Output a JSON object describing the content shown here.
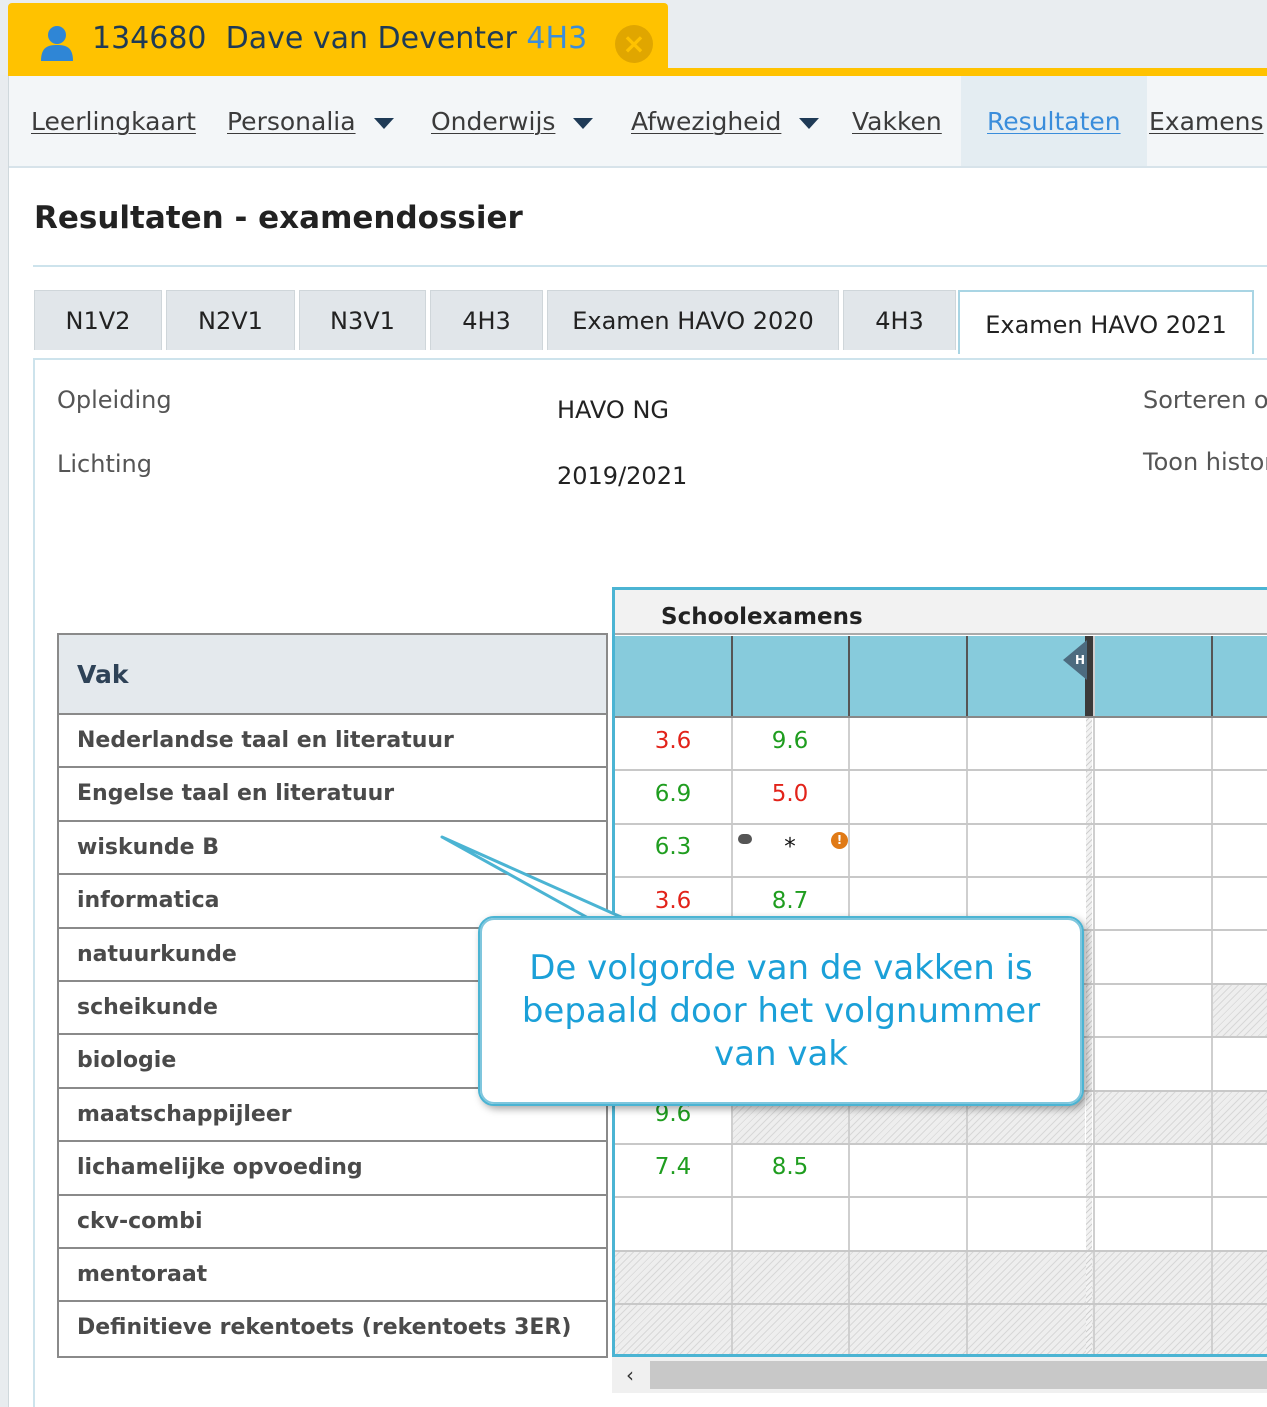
{
  "student": {
    "number": "134680",
    "name": "Dave van Deventer",
    "klas": "4H3"
  },
  "nav": {
    "items": [
      {
        "label": "Leerlingkaart",
        "dropdown": false
      },
      {
        "label": "Personalia",
        "dropdown": true
      },
      {
        "label": "Onderwijs",
        "dropdown": true
      },
      {
        "label": "Afwezigheid",
        "dropdown": true
      },
      {
        "label": "Vakken",
        "dropdown": false
      },
      {
        "label": "Resultaten",
        "dropdown": false,
        "active": true
      },
      {
        "label": "Examens",
        "dropdown": false
      }
    ]
  },
  "page": {
    "title": "Resultaten - examendossier"
  },
  "year_tabs": [
    "N1V2",
    "N2V1",
    "N3V1",
    "4H3",
    "Examen HAVO 2020",
    "4H3",
    "Examen HAVO 2021"
  ],
  "info": {
    "opleiding_label": "Opleiding",
    "opleiding_value": "HAVO NG",
    "lichting_label": "Lichting",
    "lichting_value": "2019/2021",
    "sorteren_label": "Sorteren op",
    "toon_label": "Toon historie"
  },
  "table": {
    "vak_header": "Vak",
    "group_header": "Schoolexamens",
    "marker": "H",
    "rows": [
      {
        "vak": "Nederlandse taal en literatuur",
        "g1": "3.6",
        "g1c": "red",
        "g2": "9.6",
        "g2c": "green"
      },
      {
        "vak": "Engelse taal en literatuur",
        "g1": "6.9",
        "g1c": "green",
        "g2": "5.0",
        "g2c": "red"
      },
      {
        "vak": "wiskunde B",
        "g1": "6.3",
        "g1c": "green",
        "g2": "*",
        "g2c": "black"
      },
      {
        "vak": "informatica",
        "g1": "3.6",
        "g1c": "red",
        "g2": "8.7",
        "g2c": "green"
      },
      {
        "vak": "natuurkunde",
        "g1": "",
        "g1c": "",
        "g2": "",
        "g2c": ""
      },
      {
        "vak": "scheikunde",
        "g1": "",
        "g1c": "",
        "g2": "",
        "g2c": ""
      },
      {
        "vak": "biologie",
        "g1": "",
        "g1c": "",
        "g2": "",
        "g2c": ""
      },
      {
        "vak": "maatschappijleer",
        "g1": "9.6",
        "g1c": "green",
        "g2": "",
        "g2c": ""
      },
      {
        "vak": "lichamelijke opvoeding",
        "g1": "7.4",
        "g1c": "green",
        "g2": "8.5",
        "g2c": "green"
      },
      {
        "vak": "ckv-combi",
        "g1": "",
        "g1c": "",
        "g2": "",
        "g2c": ""
      },
      {
        "vak": "mentoraat",
        "g1": "",
        "g1c": "",
        "g2": "",
        "g2c": ""
      },
      {
        "vak": "Definitieve rekentoets (rekentoets 3ER)",
        "g1": "",
        "g1c": "",
        "g2": "",
        "g2c": ""
      }
    ]
  },
  "callout": {
    "text": "De volgorde van de vakken is bepaald door het volgnummer van vak"
  },
  "colors": {
    "accent": "#ffc200",
    "link": "#3a8ddb",
    "grid_header": "#87cbdc",
    "callout_text": "#1ba0d8"
  }
}
